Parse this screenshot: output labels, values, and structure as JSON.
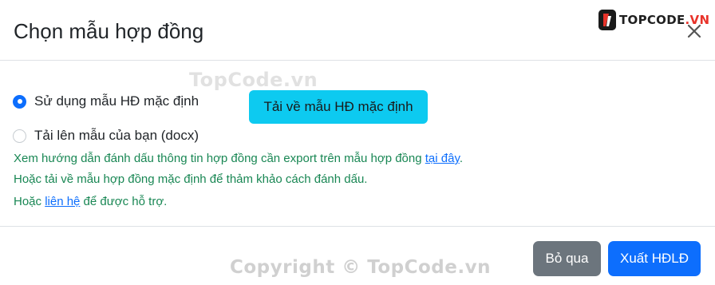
{
  "modal": {
    "title": "Chọn mẫu hợp đồng",
    "close_icon": "close-icon"
  },
  "logo": {
    "text": "TOPCODE",
    "dot_suffix": ".VN"
  },
  "watermarks": {
    "top": "TopCode.vn",
    "bottom": "Copyright © TopCode.vn"
  },
  "options": [
    {
      "label": "Sử dụng mẫu HĐ mặc định",
      "checked": true
    },
    {
      "label": "Tải lên mẫu của bạn (docx)",
      "checked": false
    }
  ],
  "download_button": "Tải về mẫu HĐ mặc định",
  "help": {
    "line1_text": "Xem hướng dẫn đánh dấu thông tin hợp đồng cần export trên mẫu hợp đồng ",
    "line1_link": "tại đây",
    "line1_end": ".",
    "line2_text": "Hoặc tải về mẫu hợp đồng mặc định để thảm khảo cách đánh dấu.",
    "line3_start": "Hoặc ",
    "line3_link": "liên hệ",
    "line3_end": " để được hỗ trợ."
  },
  "footer": {
    "cancel": "Bỏ qua",
    "export": "Xuất HĐLĐ"
  },
  "colors": {
    "primary": "#0d6efd",
    "info": "#0dcaf0",
    "secondary": "#6c757d",
    "help_text": "#198754"
  }
}
